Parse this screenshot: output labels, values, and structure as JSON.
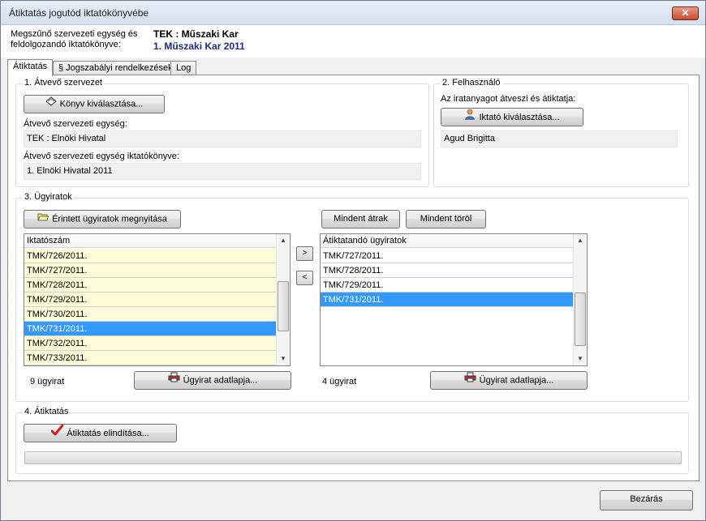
{
  "window": {
    "title": "Átiktatás jogutód iktatókönyvébe"
  },
  "header": {
    "label": "Megszűnő szervezeti egység és feldolgozandó iktatókönyve:",
    "unit": "TEK : Műszaki Kar",
    "book": "1. Műszaki Kar 2011"
  },
  "tabs": [
    {
      "label": "Átiktatás",
      "active": true
    },
    {
      "label": "§ Jogszabályi rendelkezések",
      "active": false
    },
    {
      "label": "Log",
      "active": false
    }
  ],
  "section1": {
    "title": "1. Átvevő szervezet",
    "select_book_button": "Könyv kiválasztása...",
    "unit_label": "Átvevő szervezeti egység:",
    "unit_value": "TEK : Elnöki Hivatal",
    "book_label": "Átvevő szervezeti egység iktatókönyve:",
    "book_value": "1. Elnöki Hivatal 2011"
  },
  "section2": {
    "title": "2. Felhasználó",
    "desc": "Az iratanyagot átveszi és átiktatja:",
    "select_button": "Iktató kiválasztása...",
    "user_value": "Agud Brigitta"
  },
  "section3": {
    "title": "3. Ügyiratok",
    "open_button": "Érintett ügyiratok megnyitása",
    "move_all_button": "Mindent átrak",
    "delete_all_button": "Mindent töröl",
    "left_header": "Iktatószám",
    "left_rows": [
      {
        "text": "TMK/726/2011.",
        "selected": false
      },
      {
        "text": "TMK/727/2011.",
        "selected": false
      },
      {
        "text": "TMK/728/2011.",
        "selected": false
      },
      {
        "text": "TMK/729/2011.",
        "selected": false
      },
      {
        "text": "TMK/730/2011.",
        "selected": false
      },
      {
        "text": "TMK/731/2011.",
        "selected": true
      },
      {
        "text": "TMK/732/2011.",
        "selected": false
      },
      {
        "text": "TMK/733/2011.",
        "selected": false
      }
    ],
    "right_header": "Átiktatandó ügyiratok",
    "right_rows": [
      {
        "text": "TMK/727/2011.",
        "selected": false
      },
      {
        "text": "TMK/728/2011.",
        "selected": false
      },
      {
        "text": "TMK/729/2011.",
        "selected": false
      },
      {
        "text": "TMK/731/2011.",
        "selected": true
      }
    ],
    "move_right_glyph": ">",
    "move_left_glyph": "<",
    "left_count": "9 ügyirat",
    "right_count": "4 ügyirat",
    "details_button": "Ügyirat adatlapja..."
  },
  "section4": {
    "title": "4. Átiktatás",
    "start_button": "Átiktatás elindítása...",
    "progress": 0
  },
  "footer": {
    "close_button": "Bezárás"
  },
  "colors": {
    "selection": "#3399ff",
    "yellow_row": "#fdfbd8",
    "header_book": "#1b2a80"
  }
}
